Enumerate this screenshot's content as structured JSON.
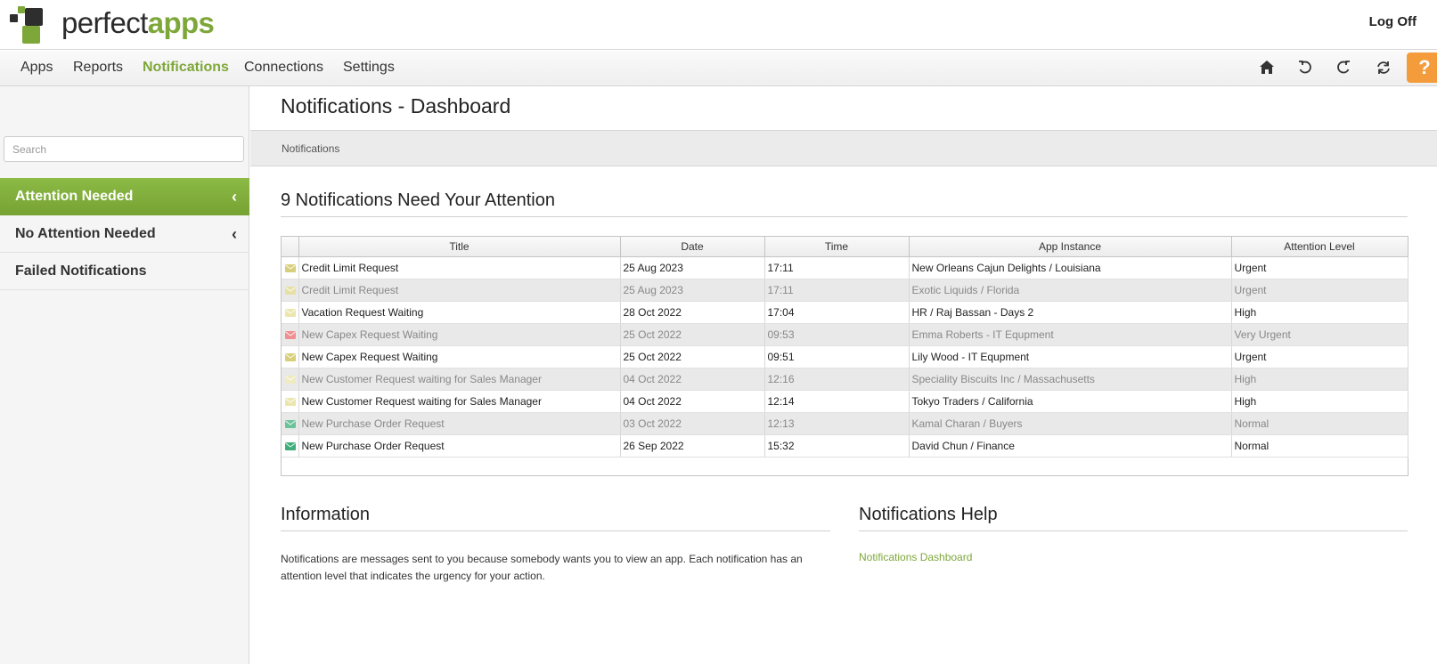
{
  "header": {
    "brand_light": "perfect",
    "brand_bold": "apps",
    "logoff_label": "Log Off"
  },
  "nav": {
    "items": [
      {
        "label": "Apps"
      },
      {
        "label": "Reports"
      },
      {
        "label": "Notifications",
        "active": true
      },
      {
        "label": "Connections"
      },
      {
        "label": "Settings"
      }
    ],
    "tools": [
      "home-icon",
      "undo-icon",
      "redo-icon",
      "sync-icon"
    ],
    "help_label": "?"
  },
  "sidebar": {
    "search_placeholder": "Search",
    "items": [
      {
        "label": "Attention Needed",
        "active": true,
        "chevron": "‹"
      },
      {
        "label": "No Attention Needed",
        "chevron": "‹"
      },
      {
        "label": "Failed Notifications"
      }
    ]
  },
  "main": {
    "title": "Notifications - Dashboard",
    "breadcrumb": "Notifications",
    "attention_heading": "9 Notifications Need Your Attention",
    "table": {
      "columns": [
        "Title",
        "Date",
        "Time",
        "App Instance",
        "Attention Level"
      ],
      "rows": [
        {
          "icon_color": "#d8cf7b",
          "title": "Credit Limit Request",
          "date": "25 Aug 2023",
          "time": "17:11",
          "instance": "New Orleans Cajun Delights / Louisiana",
          "level": "Urgent",
          "dim": false
        },
        {
          "icon_color": "#e6e0a5",
          "title": "Credit Limit Request",
          "date": "25 Aug 2023",
          "time": "17:11",
          "instance": "Exotic Liquids / Florida",
          "level": "Urgent",
          "dim": true
        },
        {
          "icon_color": "#ece6ae",
          "title": "Vacation Request Waiting",
          "date": "28 Oct 2022",
          "time": "17:04",
          "instance": "HR / Raj Bassan - Days 2",
          "level": "High",
          "dim": false
        },
        {
          "icon_color": "#ef8f8f",
          "title": "New Capex Request Waiting",
          "date": "25 Oct 2022",
          "time": "09:53",
          "instance": "Emma Roberts - IT Equpment",
          "level": "Very Urgent",
          "dim": true
        },
        {
          "icon_color": "#d8cf7b",
          "title": "New Capex Request Waiting",
          "date": "25 Oct 2022",
          "time": "09:51",
          "instance": "Lily Wood - IT Equpment",
          "level": "Urgent",
          "dim": false
        },
        {
          "icon_color": "#efeac0",
          "title": "New Customer Request waiting for Sales Manager",
          "date": "04 Oct 2022",
          "time": "12:16",
          "instance": "Speciality Biscuits Inc / Massachusetts",
          "level": "High",
          "dim": true
        },
        {
          "icon_color": "#ece6ae",
          "title": "New Customer Request waiting for Sales Manager",
          "date": "04 Oct 2022",
          "time": "12:14",
          "instance": "Tokyo Traders / California",
          "level": "High",
          "dim": false
        },
        {
          "icon_color": "#6cc39a",
          "title": "New Purchase Order Request",
          "date": "03 Oct 2022",
          "time": "12:13",
          "instance": "Kamal Charan / Buyers",
          "level": "Normal",
          "dim": true
        },
        {
          "icon_color": "#3fae7a",
          "title": "New Purchase Order Request",
          "date": "26 Sep 2022",
          "time": "15:32",
          "instance": "David Chun / Finance",
          "level": "Normal",
          "dim": false
        }
      ]
    },
    "info": {
      "heading": "Information",
      "text": "Notifications are messages sent to you because somebody wants you to view an app. Each notification has an attention level that indicates the urgency for your action."
    },
    "help": {
      "heading": "Notifications Help",
      "link": "Notifications Dashboard"
    }
  },
  "colors": {
    "accent_green": "#7ea73a",
    "help_orange": "#f49c3b"
  }
}
